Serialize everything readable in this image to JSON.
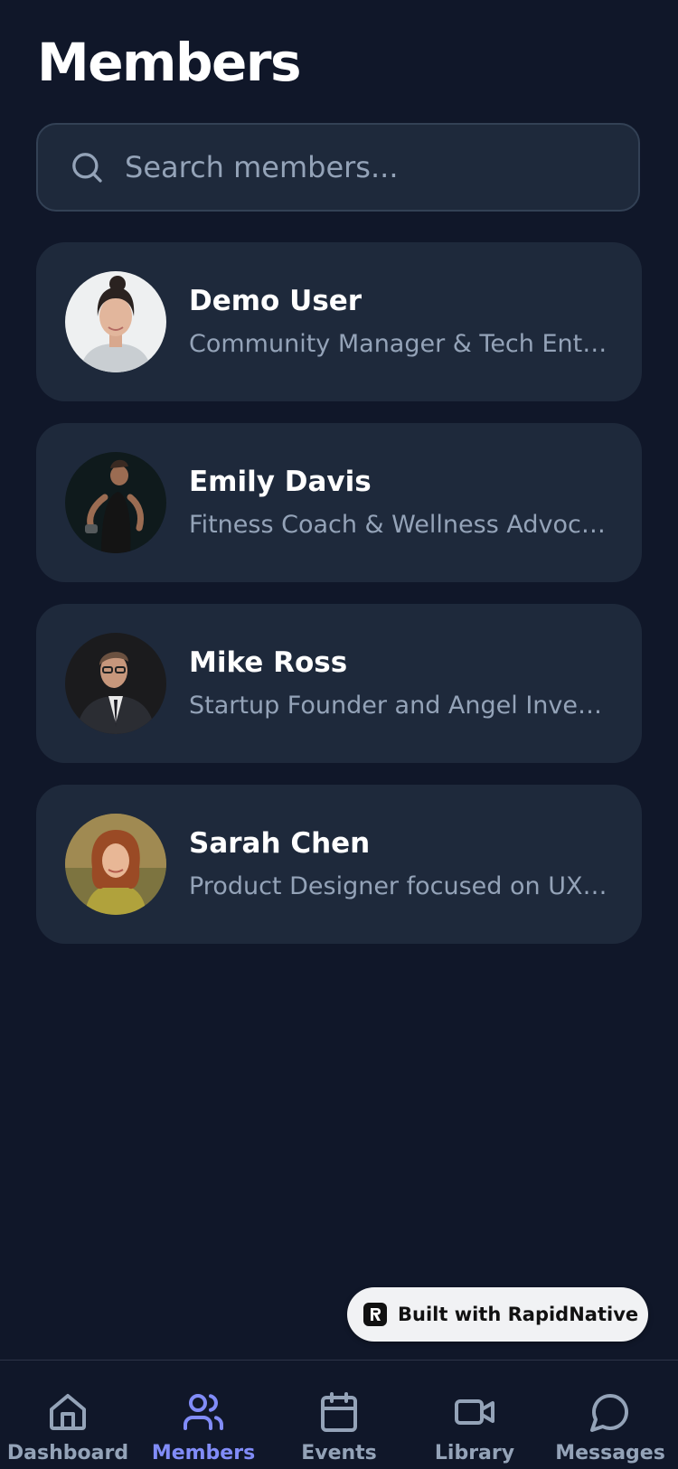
{
  "header": {
    "title": "Members"
  },
  "search": {
    "placeholder": "Search members...",
    "icon": "search-icon"
  },
  "members": [
    {
      "name": "Demo User",
      "bio": "Community Manager & Tech Enthusiast"
    },
    {
      "name": "Emily Davis",
      "bio": "Fitness Coach & Wellness Advocate."
    },
    {
      "name": "Mike Ross",
      "bio": "Startup Founder and Angel Investor"
    },
    {
      "name": "Sarah Chen",
      "bio": "Product Designer focused on UX and accessibility"
    }
  ],
  "badge": {
    "label": "Built with RapidNative",
    "icon": "rapidnative-logo-icon"
  },
  "tabs": [
    {
      "label": "Dashboard",
      "icon": "home-icon",
      "active": false
    },
    {
      "label": "Members",
      "icon": "users-icon",
      "active": true
    },
    {
      "label": "Events",
      "icon": "calendar-icon",
      "active": false
    },
    {
      "label": "Library",
      "icon": "video-icon",
      "active": false
    },
    {
      "label": "Messages",
      "icon": "chat-icon",
      "active": false
    }
  ],
  "colors": {
    "background": "#101729",
    "card": "#1e293b",
    "muted_text": "#94a3b8",
    "accent": "#818cf8"
  }
}
